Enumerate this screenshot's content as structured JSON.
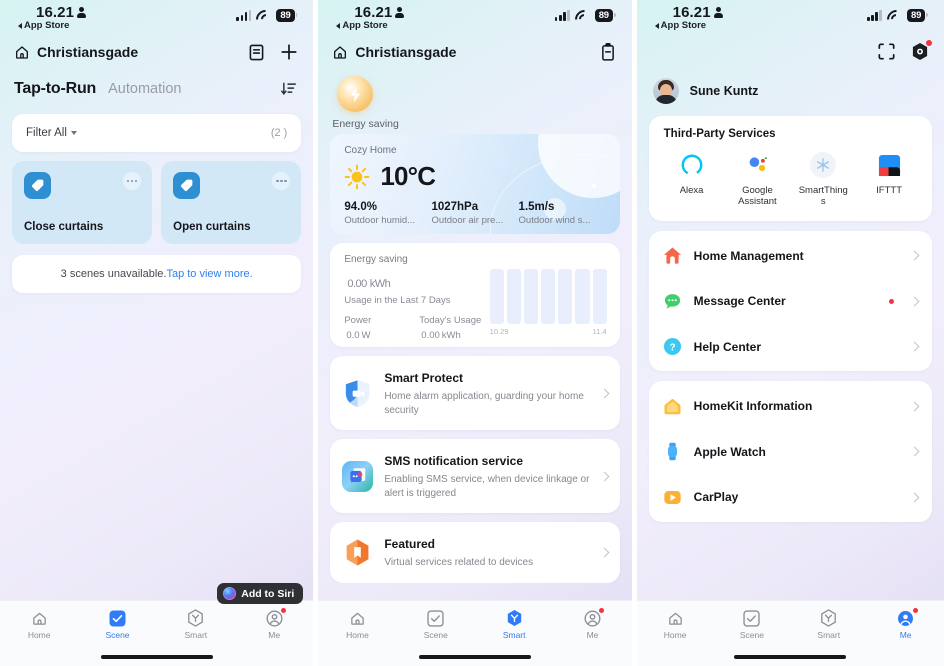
{
  "status_bar": {
    "time": "16.21",
    "back_label": "App Store",
    "battery": "89",
    "icons": {
      "person": "person-icon",
      "signal": "cellular-signal-icon",
      "wifi": "wifi-icon",
      "battery": "battery-icon"
    }
  },
  "scene_panel": {
    "home_name": "Christiansgade",
    "header_icons": {
      "list": "list-icon",
      "add": "plus-icon",
      "sort": "sort-icon"
    },
    "tabs": {
      "active": "Tap-to-Run",
      "inactive": "Automation"
    },
    "filter": {
      "label": "Filter All",
      "count": "(2 )"
    },
    "scenes": [
      {
        "name": "Close curtains",
        "icon": "tag-icon",
        "more": "more-dots-icon"
      },
      {
        "name": "Open curtains",
        "icon": "tag-icon",
        "more": "more-dots-icon"
      }
    ],
    "unavailable": {
      "text": "3 scenes unavailable.",
      "link": "Tap to view more."
    },
    "siri": {
      "label": "Add to Siri",
      "icon": "siri-orb-icon"
    }
  },
  "smart_panel": {
    "home_name": "Christiansgade",
    "header_icons": {
      "note": "clipboard-icon"
    },
    "energy_badge": {
      "label": "Energy saving",
      "icon": "bolt-icon"
    },
    "weather": {
      "title": "Cozy Home",
      "temperature": "10°C",
      "icon": "sun-icon",
      "stats": [
        {
          "value": "94.0%",
          "label": "Outdoor humid..."
        },
        {
          "value": "1027hPa",
          "label": "Outdoor air pre..."
        },
        {
          "value": "1.5m/s",
          "label": "Outdoor wind s..."
        }
      ]
    },
    "energy": {
      "title": "Energy saving",
      "total_value": "0.00",
      "total_unit": "kWh",
      "total_sub": "Usage in the Last 7 Days",
      "metrics": [
        {
          "label": "Power",
          "value": "0.0",
          "unit": "W"
        },
        {
          "label": "Today's Usage",
          "value": "0.00",
          "unit": "kWh"
        }
      ],
      "axis_start": "10.29",
      "axis_end": "11.4"
    },
    "services": [
      {
        "title": "Smart Protect",
        "desc": "Home alarm application, guarding your home security",
        "icon": "shield-camera-icon"
      },
      {
        "title": "SMS notification service",
        "desc": "Enabling SMS service,  when device linkage or alert is triggered",
        "icon": "sms-icon"
      },
      {
        "title": "Featured",
        "desc": "Virtual services related to devices",
        "icon": "featured-icon"
      }
    ]
  },
  "me_panel": {
    "header_icons": {
      "scan": "scan-icon",
      "settings": "settings-shield-icon"
    },
    "profile": {
      "name": "Sune Kuntz",
      "avatar": "user-avatar"
    },
    "third_party": {
      "title": "Third-Party Services",
      "items": [
        {
          "label": "Alexa",
          "icon": "alexa-icon"
        },
        {
          "label": "Google Assistant",
          "icon": "google-assistant-icon"
        },
        {
          "label": "SmartThings",
          "icon": "smartthings-icon"
        },
        {
          "label": "IFTTT",
          "icon": "ifttt-icon"
        }
      ]
    },
    "menu_group_1": [
      {
        "label": "Home Management",
        "icon": "home-filled-icon",
        "badge": false
      },
      {
        "label": "Message Center",
        "icon": "chat-bubble-icon",
        "badge": true
      },
      {
        "label": "Help Center",
        "icon": "question-circle-icon",
        "badge": false
      }
    ],
    "menu_group_2": [
      {
        "label": "HomeKit Information",
        "icon": "homekit-icon",
        "badge": false
      },
      {
        "label": "Apple Watch",
        "icon": "apple-watch-icon",
        "badge": false
      },
      {
        "label": "CarPlay",
        "icon": "carplay-icon",
        "badge": false
      }
    ]
  },
  "tabbar": {
    "items": [
      {
        "label": "Home",
        "icon": "home-icon"
      },
      {
        "label": "Scene",
        "icon": "scene-check-icon"
      },
      {
        "label": "Smart",
        "icon": "smart-hex-icon"
      },
      {
        "label": "Me",
        "icon": "me-person-icon"
      }
    ],
    "active_panel_1": "Scene",
    "active_panel_2": "Smart",
    "active_panel_3": "Me"
  },
  "colors": {
    "accent": "#2f7cf6",
    "scene_card_bg": "#d2e8f7",
    "scene_icon_bg": "#2f8fd3",
    "badge_red": "#f5333f",
    "link_blue": "#2f82ef"
  }
}
